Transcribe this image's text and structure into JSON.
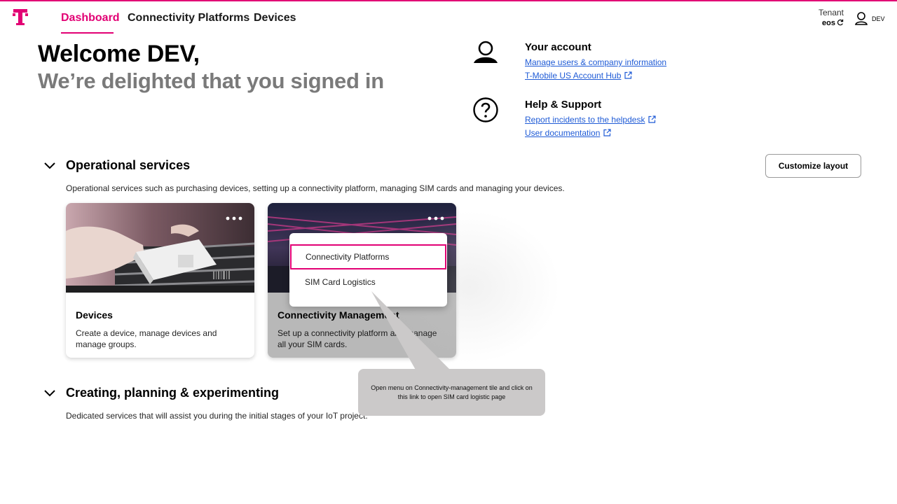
{
  "colors": {
    "brand": "#e20074",
    "link": "#1f5bd6",
    "callout": "#cbc9c9"
  },
  "header": {
    "logo_icon": "t-logo-icon",
    "nav": [
      "Dashboard",
      "Connectivity Platforms",
      "Devices"
    ],
    "active_nav": "Dashboard",
    "tenant_label": "Tenant",
    "tenant_value": "eos",
    "user_label": "DEV"
  },
  "welcome": {
    "line1": "Welcome DEV,",
    "line2": "We’re delighted that you signed in"
  },
  "account": {
    "title": "Your account",
    "links": [
      "Manage users & company information",
      "T-Mobile US Account Hub"
    ]
  },
  "help": {
    "title": "Help & Support",
    "links": [
      "Report incidents to the helpdesk",
      "User documentation"
    ]
  },
  "operational": {
    "title": "Operational services",
    "description": "Operational services such as purchasing devices, setting up a connectivity platform, managing SIM cards and managing your devices.",
    "customize_label": "Customize layout",
    "tiles": [
      {
        "title": "Devices",
        "description": "Create a device, manage devices and manage groups."
      },
      {
        "title": "Connectivity Management",
        "description": "Set up a connectivity platform and manage all your SIM cards."
      }
    ]
  },
  "dropdown": {
    "items": [
      "Connectivity Platforms",
      "SIM Card Logistics"
    ],
    "highlighted": "Connectivity Platforms"
  },
  "creating": {
    "title": "Creating, planning & experimenting",
    "description": "Dedicated services that will assist you during the initial stages of your IoT project."
  },
  "callout": {
    "text": "Open menu on Connectivity-management tile and click on this link to open SIM card logistic page"
  }
}
